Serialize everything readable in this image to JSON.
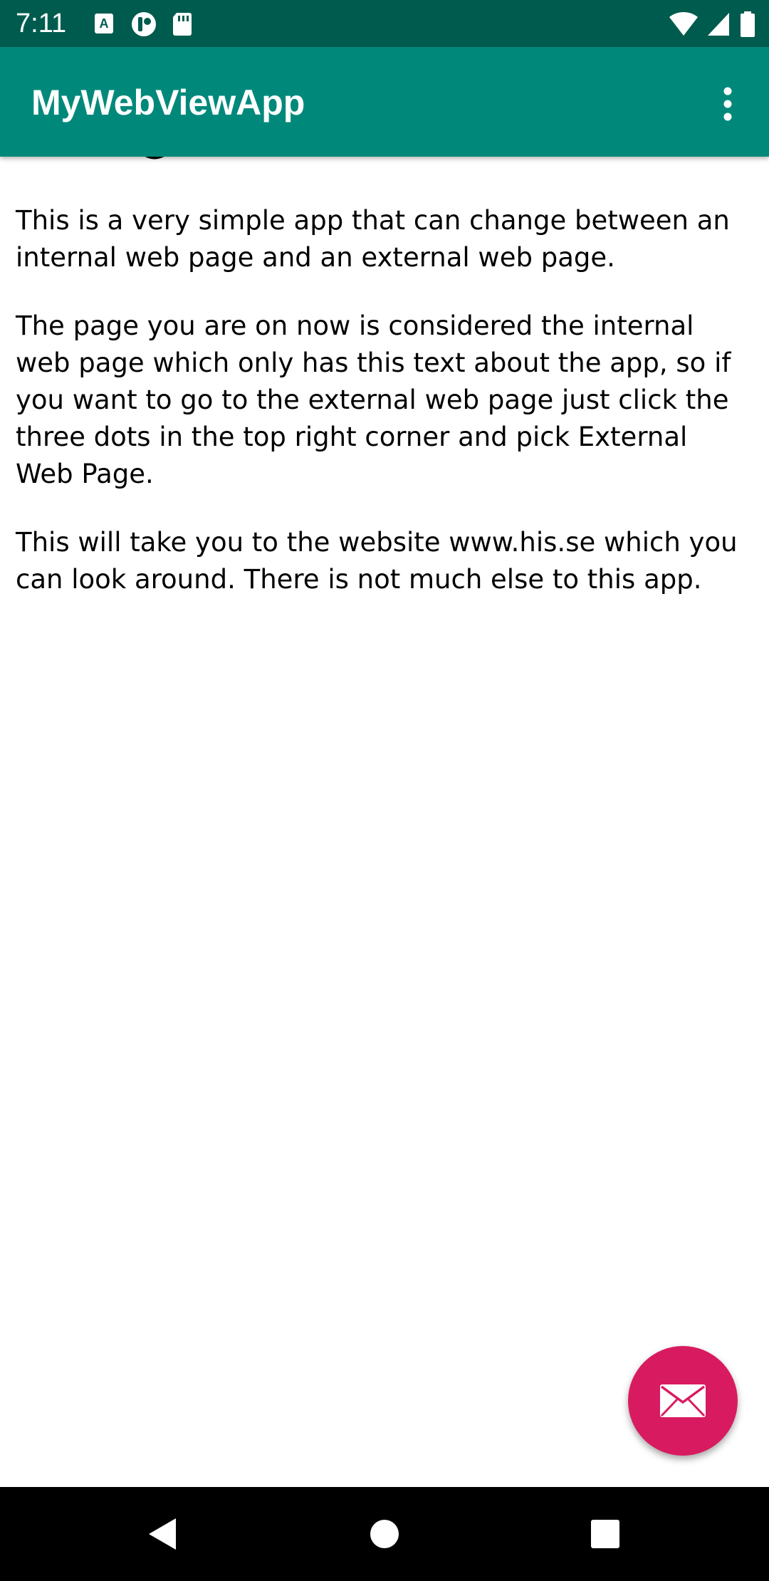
{
  "status_bar": {
    "time": "7:11",
    "background": "#005b4f",
    "notification_icons": [
      "text-a-icon",
      "sync-circle-icon",
      "sd-card-icon"
    ],
    "system_icons": [
      "wifi-icon",
      "cell-signal-icon",
      "battery-icon"
    ]
  },
  "app_bar": {
    "title": "MyWebViewApp",
    "background": "#00897b",
    "overflow_icon": "more-vert-icon"
  },
  "web_content": {
    "paragraphs": [
      "This is a very simple app that can change between an internal web page and an external web page.",
      "The page you are on now is considered the internal web page which only has this text about the app, so if you want to go to the external web page just click the three dots in the top right corner and pick External Web Page.",
      "This will take you to the website www.his.se which you can look around. There is not much else to this app."
    ]
  },
  "fab": {
    "icon": "email-icon",
    "color": "#d81b60"
  },
  "nav_bar": {
    "buttons": [
      "back-icon",
      "home-icon",
      "recents-icon"
    ]
  }
}
